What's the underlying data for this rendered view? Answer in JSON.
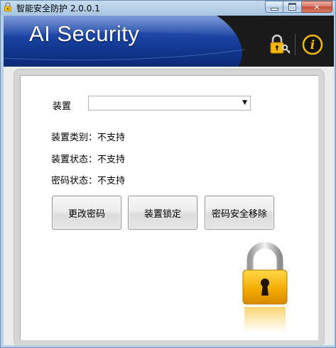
{
  "window": {
    "title": "智能安全防护 2.0.0.1",
    "caption_buttons": {
      "minimize": "minimize",
      "maximize": "maximize",
      "close": "close"
    }
  },
  "banner": {
    "title": "AI Security",
    "icons": [
      "lock-key-icon",
      "info-icon"
    ]
  },
  "form": {
    "device_label": "装置",
    "device_select_value": "",
    "device_type_label": "装置类别：",
    "device_type_value": "不支持",
    "device_status_label": "装置状态：",
    "device_status_value": "不支持",
    "password_status_label": "密码状态：",
    "password_status_value": "不支持"
  },
  "actions": {
    "change_password": "更改密码",
    "lock_device": "装置锁定",
    "secure_remove": "密码安全移除"
  },
  "colors": {
    "banner_blue": "#123a8a",
    "banner_dark": "#1c1c1c",
    "lock_gold": "#f0b400"
  }
}
